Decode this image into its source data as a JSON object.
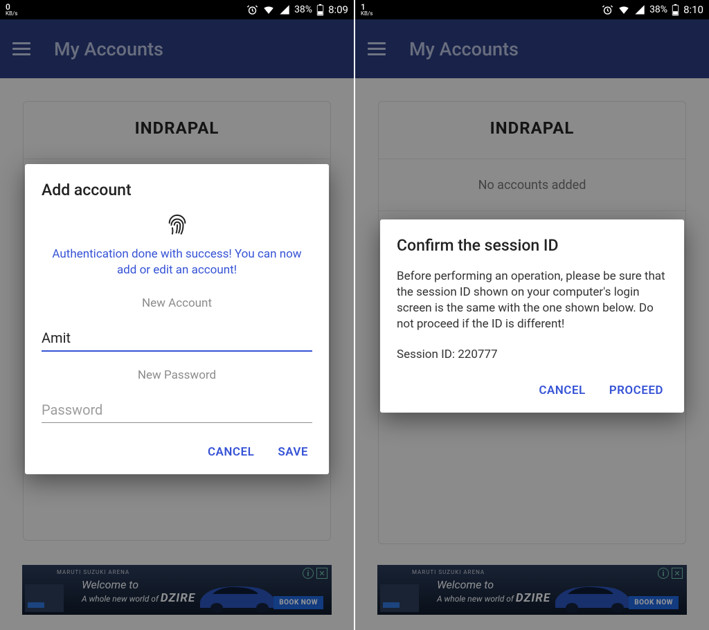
{
  "left": {
    "status": {
      "kbs_num": "0",
      "kbs_unit": "KB/s",
      "battery_pct": "38%",
      "time": "8:09"
    },
    "appbar": {
      "title": "My Accounts"
    },
    "card": {
      "title": "INDRAPAL"
    },
    "dialog": {
      "title": "Add account",
      "auth_msg": "Authentication done with success! You can now add or edit an account!",
      "field_account_label": "New Account",
      "account_value": "Amit",
      "field_password_label": "New Password",
      "password_placeholder": "Password",
      "cancel": "CANCEL",
      "save": "SAVE"
    },
    "ad": {
      "brand": "MARUTI SUZUKI ARENA",
      "line1": "Welcome to",
      "line2_prefix": "A whole new world of ",
      "line2_bold": "DZIRE",
      "cta": "BOOK NOW"
    }
  },
  "right": {
    "status": {
      "kbs_num": "1",
      "kbs_unit": "KB/s",
      "battery_pct": "38%",
      "time": "8:10"
    },
    "appbar": {
      "title": "My Accounts"
    },
    "card": {
      "title": "INDRAPAL",
      "empty": "No accounts added"
    },
    "dialog": {
      "title": "Confirm the session ID",
      "body": "Before performing an operation, please be sure that the session ID shown on your computer's login screen is the same with the one shown below. Do not proceed if the ID is different!",
      "session_label": "Session ID: ",
      "session_id": "220777",
      "cancel": "CANCEL",
      "proceed": "PROCEED"
    },
    "ad": {
      "brand": "MARUTI SUZUKI ARENA",
      "line1": "Welcome to",
      "line2_prefix": "A whole new world of ",
      "line2_bold": "DZIRE",
      "cta": "BOOK NOW"
    }
  }
}
